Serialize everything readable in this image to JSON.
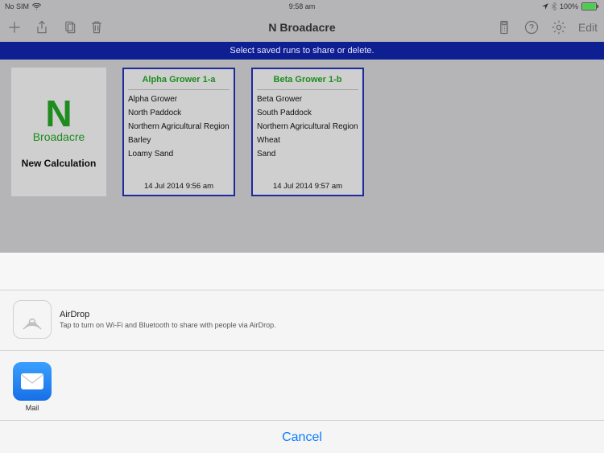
{
  "status": {
    "carrier": "No SIM",
    "time": "9:58 am",
    "battery_pct": "100%"
  },
  "toolbar": {
    "title": "N Broadacre",
    "edit_label": "Edit"
  },
  "instruction": "Select saved runs to share or delete.",
  "new_calc": {
    "big_n": "N",
    "brand": "Broadacre",
    "label": "New Calculation"
  },
  "cards": [
    {
      "title": "Alpha Grower 1-a",
      "lines": [
        "Alpha Grower",
        "North Paddock",
        "Northern Agricultural Region",
        "Barley",
        "Loamy Sand"
      ],
      "date": "14 Jul 2014 9:56 am"
    },
    {
      "title": "Beta Grower 1-b",
      "lines": [
        "Beta Grower",
        "South Paddock",
        "Northern Agricultural Region",
        "Wheat",
        "Sand"
      ],
      "date": "14 Jul 2014 9:57 am"
    }
  ],
  "sheet": {
    "airdrop_title": "AirDrop",
    "airdrop_desc": "Tap to turn on Wi-Fi and Bluetooth to share with people via AirDrop.",
    "apps": [
      {
        "name": "Mail"
      }
    ],
    "cancel": "Cancel"
  }
}
